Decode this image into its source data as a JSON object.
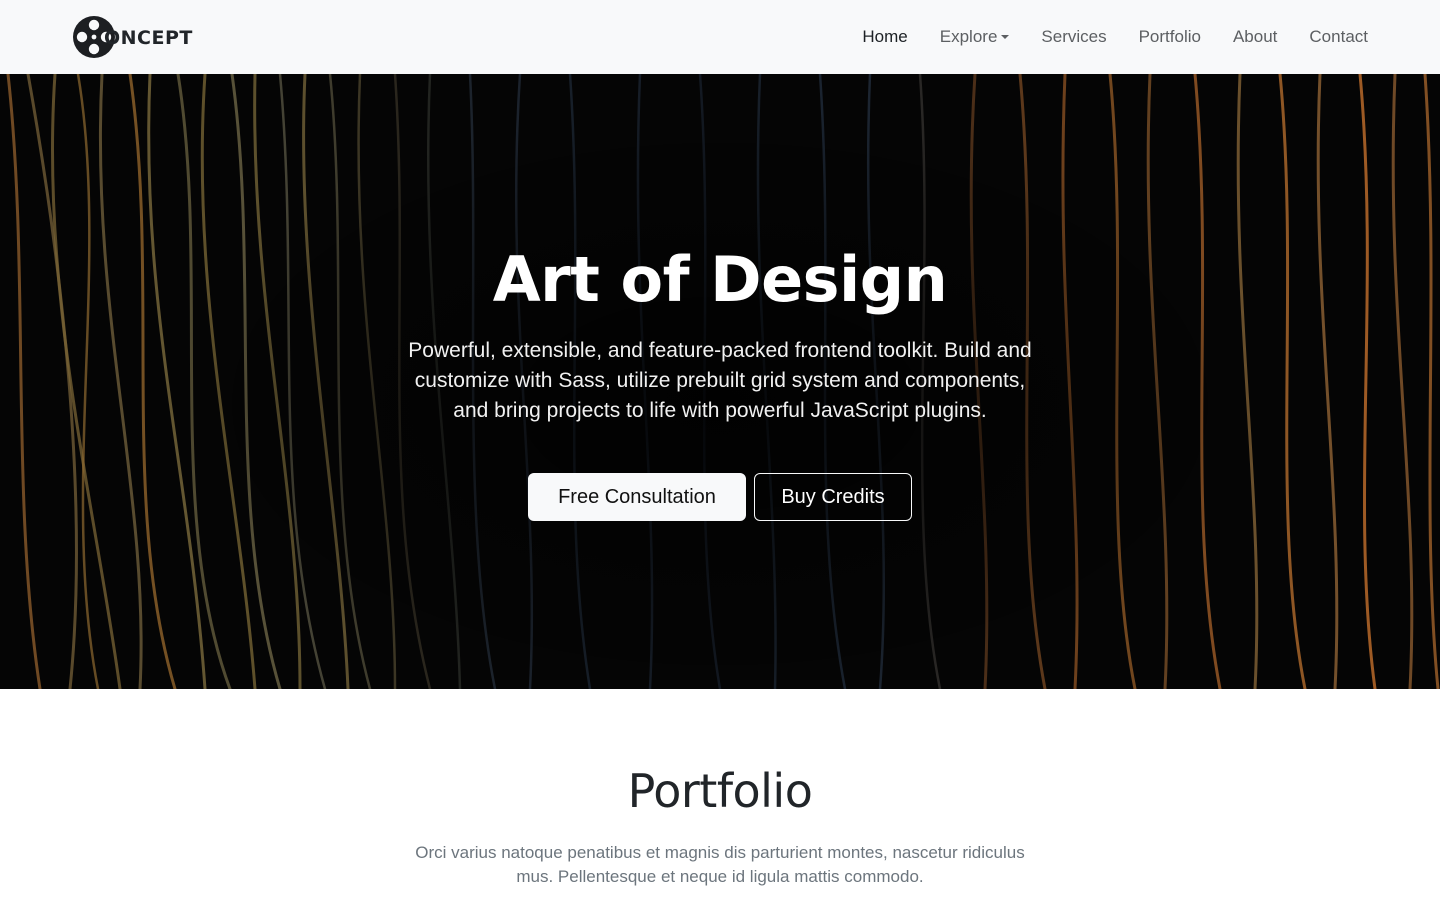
{
  "brand": {
    "name": "ONCEPT",
    "logo_icon": "film-reel-icon"
  },
  "nav": {
    "items": [
      {
        "label": "Home",
        "active": true
      },
      {
        "label": "Explore",
        "dropdown": true
      },
      {
        "label": "Services"
      },
      {
        "label": "Portfolio"
      },
      {
        "label": "About"
      },
      {
        "label": "Contact"
      }
    ]
  },
  "hero": {
    "title": "Art of Design",
    "lead": "Powerful, extensible, and feature-packed frontend toolkit. Build and customize with Sass, utilize prebuilt grid system and components, and bring projects to life with powerful JavaScript plugins.",
    "primary_button": "Free Consultation",
    "secondary_button": "Buy Credits"
  },
  "portfolio": {
    "title": "Portfolio",
    "text": "Orci varius natoque penatibus et magnis dis parturient montes, nascetur ridiculus mus. Pellentesque et neque id ligula mattis commodo."
  },
  "colors": {
    "navbar_bg": "#f8f9fa",
    "hero_bg": "#050505",
    "text_dark": "#212529",
    "text_muted": "#6c757d",
    "button_light": "#f8f9fa"
  }
}
